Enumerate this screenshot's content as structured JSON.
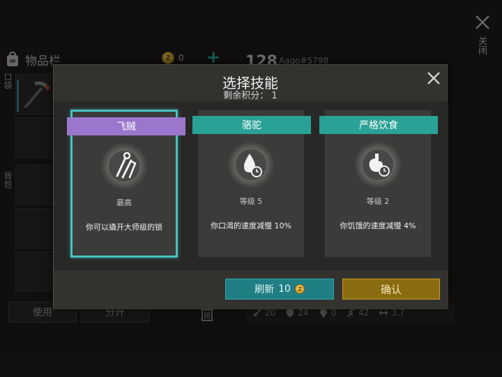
{
  "background": {
    "inventory_title": "物品栏",
    "coins": "0",
    "plus_label": "+",
    "player_level": "128",
    "player_name": "Aago#5798",
    "close_label": "关闭",
    "pocket_label": "口袋",
    "backpack_label": "背包",
    "use_button": "使用",
    "split_button": "分开",
    "stats": [
      "20",
      "24",
      "0",
      "42",
      "3.7"
    ]
  },
  "dialog": {
    "title": "选择技能",
    "points_label": "剩余积分：",
    "points_value": "1",
    "refresh_label": "刷新",
    "refresh_cost": "10",
    "confirm_label": "确认"
  },
  "skills": [
    {
      "name": "飞贼",
      "level": "最高",
      "description": "你可以撬开大师级的锁",
      "ribbon_color": "#9a76cc",
      "icon": "lockpick-icon",
      "selected": true
    },
    {
      "name": "骆驼",
      "level": "等级 5",
      "description": "你口渴的速度减慢 10%",
      "ribbon_color": "#2aa196",
      "icon": "water-drop-clock-icon",
      "selected": false
    },
    {
      "name": "严格饮食",
      "level": "等级 2",
      "description": "你饥饿的速度减慢 4%",
      "ribbon_color": "#2aa196",
      "icon": "stomach-clock-icon",
      "selected": false
    }
  ]
}
